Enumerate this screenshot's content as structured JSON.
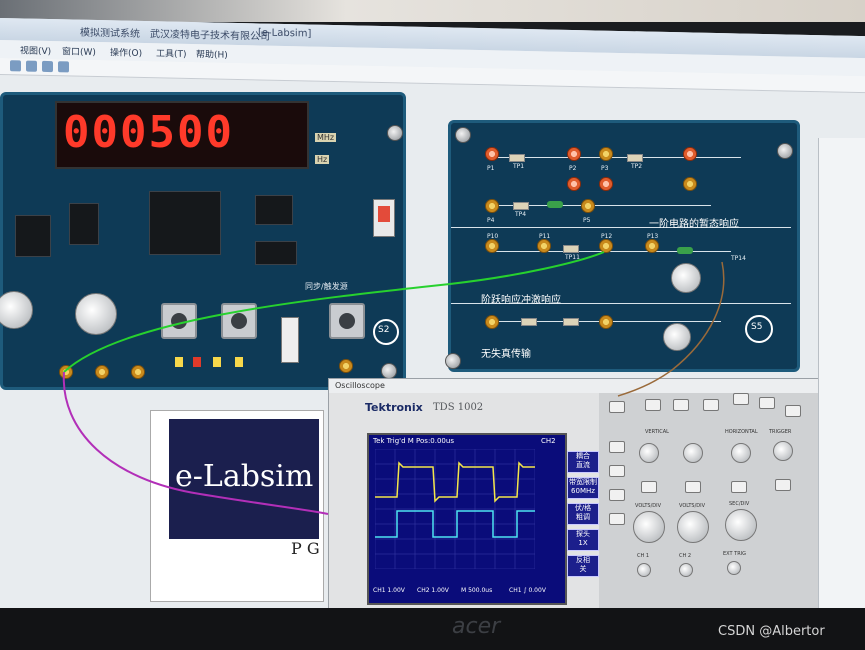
{
  "app": {
    "title_prefix": "模拟测试系统",
    "title_company": "武汉凌特电子技术有限公司",
    "title_app": "[e-Labsim]",
    "menus": [
      "视图(V)",
      "窗口(W)",
      "操作(O)",
      "工具(T)",
      "帮助(H)"
    ]
  },
  "counter": {
    "digits": "000500",
    "unit_mhz": "MHz",
    "unit_hz": "Hz"
  },
  "circuit_board": {
    "label_first_order": "一阶电路的暂态响应",
    "label_step": "阶跃响应冲激响应",
    "label_lossless": "无失真传输",
    "module_id": "S5",
    "point_labels": [
      "P1",
      "TP1",
      "P2",
      "P3",
      "TP2",
      "P4",
      "TP4",
      "P5",
      "P10",
      "P11",
      "TP11",
      "P12",
      "P13",
      "TP14"
    ]
  },
  "left_board": {
    "module_id": "S2",
    "switch_label": "同步/触发源"
  },
  "logo": {
    "text": "e-Labsim",
    "pg": "P G"
  },
  "oscilloscope": {
    "window_title": "Oscilloscope",
    "brand": "Tektronix",
    "model": "TDS 1002",
    "status_line": "Tek  Trig'd  M Pos:0.00us",
    "ch_label": "CH2",
    "side_menu": [
      "耦合",
      "带宽限制",
      "伏/格",
      "探头",
      "反相"
    ],
    "side_values": [
      "直流",
      "60MHz",
      "粗调",
      "1X",
      "关"
    ],
    "footer": [
      "CH1 1.00V",
      "CH2 1.00V",
      "M 500.0us",
      "CH1 ∫ 0.00V"
    ],
    "panel_sections": [
      "VERTICAL",
      "HORIZONTAL",
      "TRIGGER"
    ],
    "panel_knobs": [
      "VOLTS/DIV",
      "VOLTS/DIV",
      "SEC/DIV"
    ],
    "bottom_ports": [
      "CH 1",
      "CH 2",
      "EXT TRIG"
    ]
  },
  "watermark": "CSDN @Albertor",
  "bezel_brand": "acer",
  "colors": {
    "board_blue": "#0e3a56",
    "led_red": "#ff3a2a",
    "trace_ch1": "#f4e64a",
    "trace_ch2": "#4ee4f2",
    "scope_screen": "#0a0c7a",
    "wire_green": "#27d12e",
    "wire_purple": "#b22fb8",
    "wire_brown": "#9a6a3a"
  }
}
